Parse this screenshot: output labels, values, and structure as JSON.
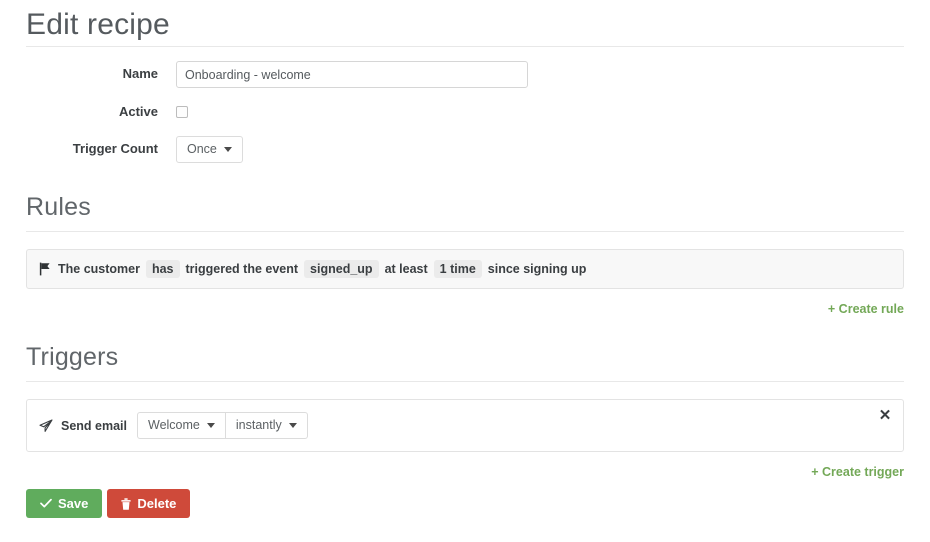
{
  "page": {
    "title": "Edit recipe"
  },
  "form": {
    "name": {
      "label": "Name",
      "value": "Onboarding - welcome",
      "placeholder": ""
    },
    "active": {
      "label": "Active",
      "checked": false
    },
    "trigger_count": {
      "label": "Trigger Count",
      "value": "Once"
    }
  },
  "rules": {
    "heading": "Rules",
    "icon": "flag-icon",
    "items": [
      {
        "parts": [
          {
            "type": "text",
            "text": "The customer"
          },
          {
            "type": "token",
            "text": "has"
          },
          {
            "type": "text",
            "text": "triggered the event"
          },
          {
            "type": "token",
            "text": "signed_up"
          },
          {
            "type": "text",
            "text": "at least"
          },
          {
            "type": "token",
            "text": "1 time"
          },
          {
            "type": "text",
            "text": "since signing up"
          }
        ]
      }
    ],
    "create_link": "+ Create rule"
  },
  "triggers": {
    "heading": "Triggers",
    "icon": "paper-plane-icon",
    "items": [
      {
        "label": "Send email",
        "dropdowns": [
          "Welcome",
          "instantly"
        ],
        "close_label": "✕"
      }
    ],
    "create_link": "+ Create trigger"
  },
  "footer": {
    "save_label": "Save",
    "save_icon": "check-icon",
    "delete_label": "Delete",
    "delete_icon": "trash-icon"
  },
  "colors": {
    "save_green": "#60ac5d",
    "delete_red": "#cf4a3a",
    "link_green": "#73a857",
    "token_bg": "#ebebeb",
    "border": "#e3e3e3"
  }
}
